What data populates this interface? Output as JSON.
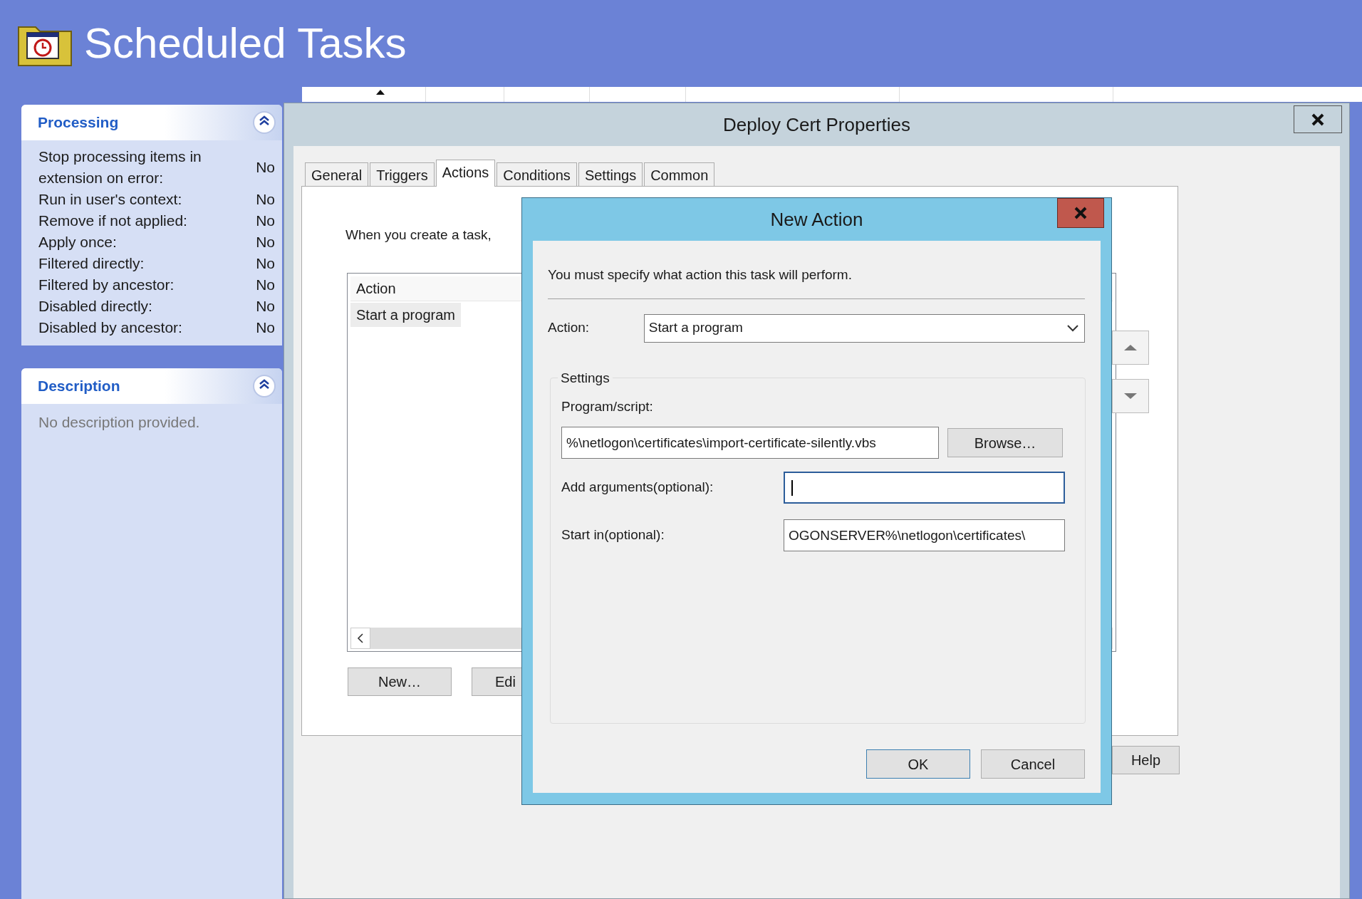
{
  "app": {
    "title": "Scheduled Tasks"
  },
  "table": {
    "columns": [
      {
        "sorted": true
      },
      {
        "sorted": false
      },
      {
        "sorted": false
      },
      {
        "sorted": false
      },
      {
        "sorted": false
      },
      {
        "sorted": false
      }
    ]
  },
  "processing": {
    "title": "Processing",
    "expanded": true,
    "rows": [
      {
        "label": "Stop processing items in extension on error:",
        "value": "No"
      },
      {
        "label": "Run in user's context:",
        "value": "No"
      },
      {
        "label": "Remove if not applied:",
        "value": "No"
      },
      {
        "label": "Apply once:",
        "value": "No"
      },
      {
        "label": "Filtered directly:",
        "value": "No"
      },
      {
        "label": "Filtered by ancestor:",
        "value": "No"
      },
      {
        "label": "Disabled directly:",
        "value": "No"
      },
      {
        "label": "Disabled by ancestor:",
        "value": "No"
      }
    ]
  },
  "description": {
    "title": "Description",
    "expanded": true,
    "text": "No description provided."
  },
  "properties_window": {
    "title": "Deploy Cert Properties",
    "tabs": [
      {
        "label": "General",
        "selected": false
      },
      {
        "label": "Triggers",
        "selected": false
      },
      {
        "label": "Actions",
        "selected": true
      },
      {
        "label": "Conditions",
        "selected": false
      },
      {
        "label": "Settings",
        "selected": false
      },
      {
        "label": "Common",
        "selected": false
      }
    ],
    "intro": "When you create a task,",
    "actions_list": {
      "column": "Action",
      "rows": [
        {
          "text": "Start a program",
          "selected": true
        }
      ]
    },
    "buttons": [
      "New…",
      "Edi"
    ],
    "help_button": "Help"
  },
  "new_action": {
    "title": "New Action",
    "instruction": "You must specify what action this task will perform.",
    "action_label": "Action:",
    "action_value": "Start a program",
    "settings_title": "Settings",
    "program_label": "Program/script:",
    "program_value": "%\\netlogon\\certificates\\import-certificate-silently.vbs",
    "browse_button": "Browse…",
    "fields": [
      {
        "label": "Add arguments(optional):",
        "focused": true
      },
      {
        "label": "Start in(optional):",
        "value": "OGONSERVER%\\netlogon\\certificates\\",
        "focused": false
      }
    ],
    "buttons": [
      {
        "label": "OK",
        "default": true
      },
      {
        "label": "Cancel",
        "default": false
      }
    ]
  }
}
